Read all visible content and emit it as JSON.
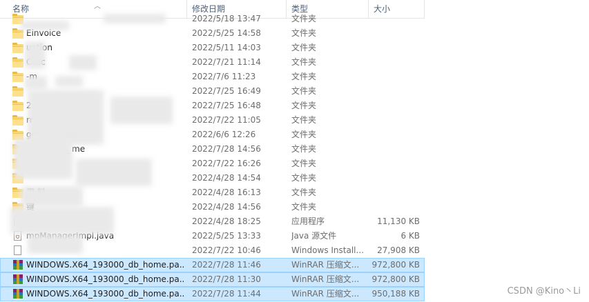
{
  "columns": {
    "name": "名称",
    "date": "修改日期",
    "type": "类型",
    "size": "大小"
  },
  "rows": [
    {
      "name": "",
      "date": "2022/5/18 13:47",
      "type": "文件夹",
      "size": "",
      "icon": "folder-icon"
    },
    {
      "name": "Einvoice",
      "date": "2022/5/25 14:58",
      "type": "文件夹",
      "size": "",
      "icon": "folder-icon"
    },
    {
      "name": "uation",
      "date": "2022/5/11 14:03",
      "type": "文件夹",
      "size": "",
      "icon": "folder-icon"
    },
    {
      "name": "Offic",
      "date": "2022/7/21 11:14",
      "type": "文件夹",
      "size": "",
      "icon": "folder-icon"
    },
    {
      "name": "-m",
      "date": "2022/7/6 11:23",
      "type": "文件夹",
      "size": "",
      "icon": "folder-icon"
    },
    {
      "name": "",
      "date": "2022/7/25 16:49",
      "type": "文件夹",
      "size": "",
      "icon": "folder-icon"
    },
    {
      "name": "2.0.  20  no-",
      "date": "2022/7/25 16:48",
      "type": "文件夹",
      "size": "",
      "icon": "folder-icon"
    },
    {
      "name": "rm",
      "date": "2022/7/22 11:05",
      "type": "文件夹",
      "size": "",
      "icon": "folder-icon"
    },
    {
      "name": "gon",
      "date": "2022/6/6 12:26",
      "type": "文件夹",
      "size": "",
      "icon": "folder-icon"
    },
    {
      "name": "X64_1  00_  me",
      "date": "2022/7/28 14:56",
      "type": "文件夹",
      "size": "",
      "icon": "folder-icon"
    },
    {
      "name": "",
      "date": "2022/7/22 16:26",
      "type": "文件夹",
      "size": "",
      "icon": "folder-icon"
    },
    {
      "name": "",
      "date": "2022/4/28 14:54",
      "type": "文件夹",
      "size": "",
      "icon": "folder-icon"
    },
    {
      "name": "周  料",
      "date": "2022/4/28 16:13",
      "type": "文件夹",
      "size": "",
      "icon": "folder-icon"
    },
    {
      "name": "键",
      "date": "2022/4/28 14:56",
      "type": "文件夹",
      "size": "",
      "icon": "folder-icon"
    },
    {
      "name": "x",
      "date": "2022/4/28 18:25",
      "type": "应用程序",
      "size": "11,130 KB",
      "icon": "file-icon"
    },
    {
      "name": "mpManagerImpl.java",
      "date": "2022/5/25 13:33",
      "type": "Java 源文件",
      "size": "6 KB",
      "icon": "java-icon"
    },
    {
      "name": "",
      "date": "2022/7/22 10:46",
      "type": "Windows Install...",
      "size": "27,908 KB",
      "icon": "file-icon"
    },
    {
      "name": "WINDOWS.X64_193000_db_home.pa...",
      "date": "2022/7/28 11:46",
      "type": "WinRAR 压缩文...",
      "size": "972,800 KB",
      "icon": "rar-icon"
    },
    {
      "name": "WINDOWS.X64_193000_db_home.pa...",
      "date": "2022/7/28 11:30",
      "type": "WinRAR 压缩文...",
      "size": "972,800 KB",
      "icon": "rar-icon"
    },
    {
      "name": "WINDOWS.X64_193000_db_home.pa...",
      "date": "2022/7/28 11:44",
      "type": "WinRAR 压缩文...",
      "size": "950,188 KB",
      "icon": "rar-icon"
    }
  ],
  "watermark": "CSDN @Kino丶Li"
}
